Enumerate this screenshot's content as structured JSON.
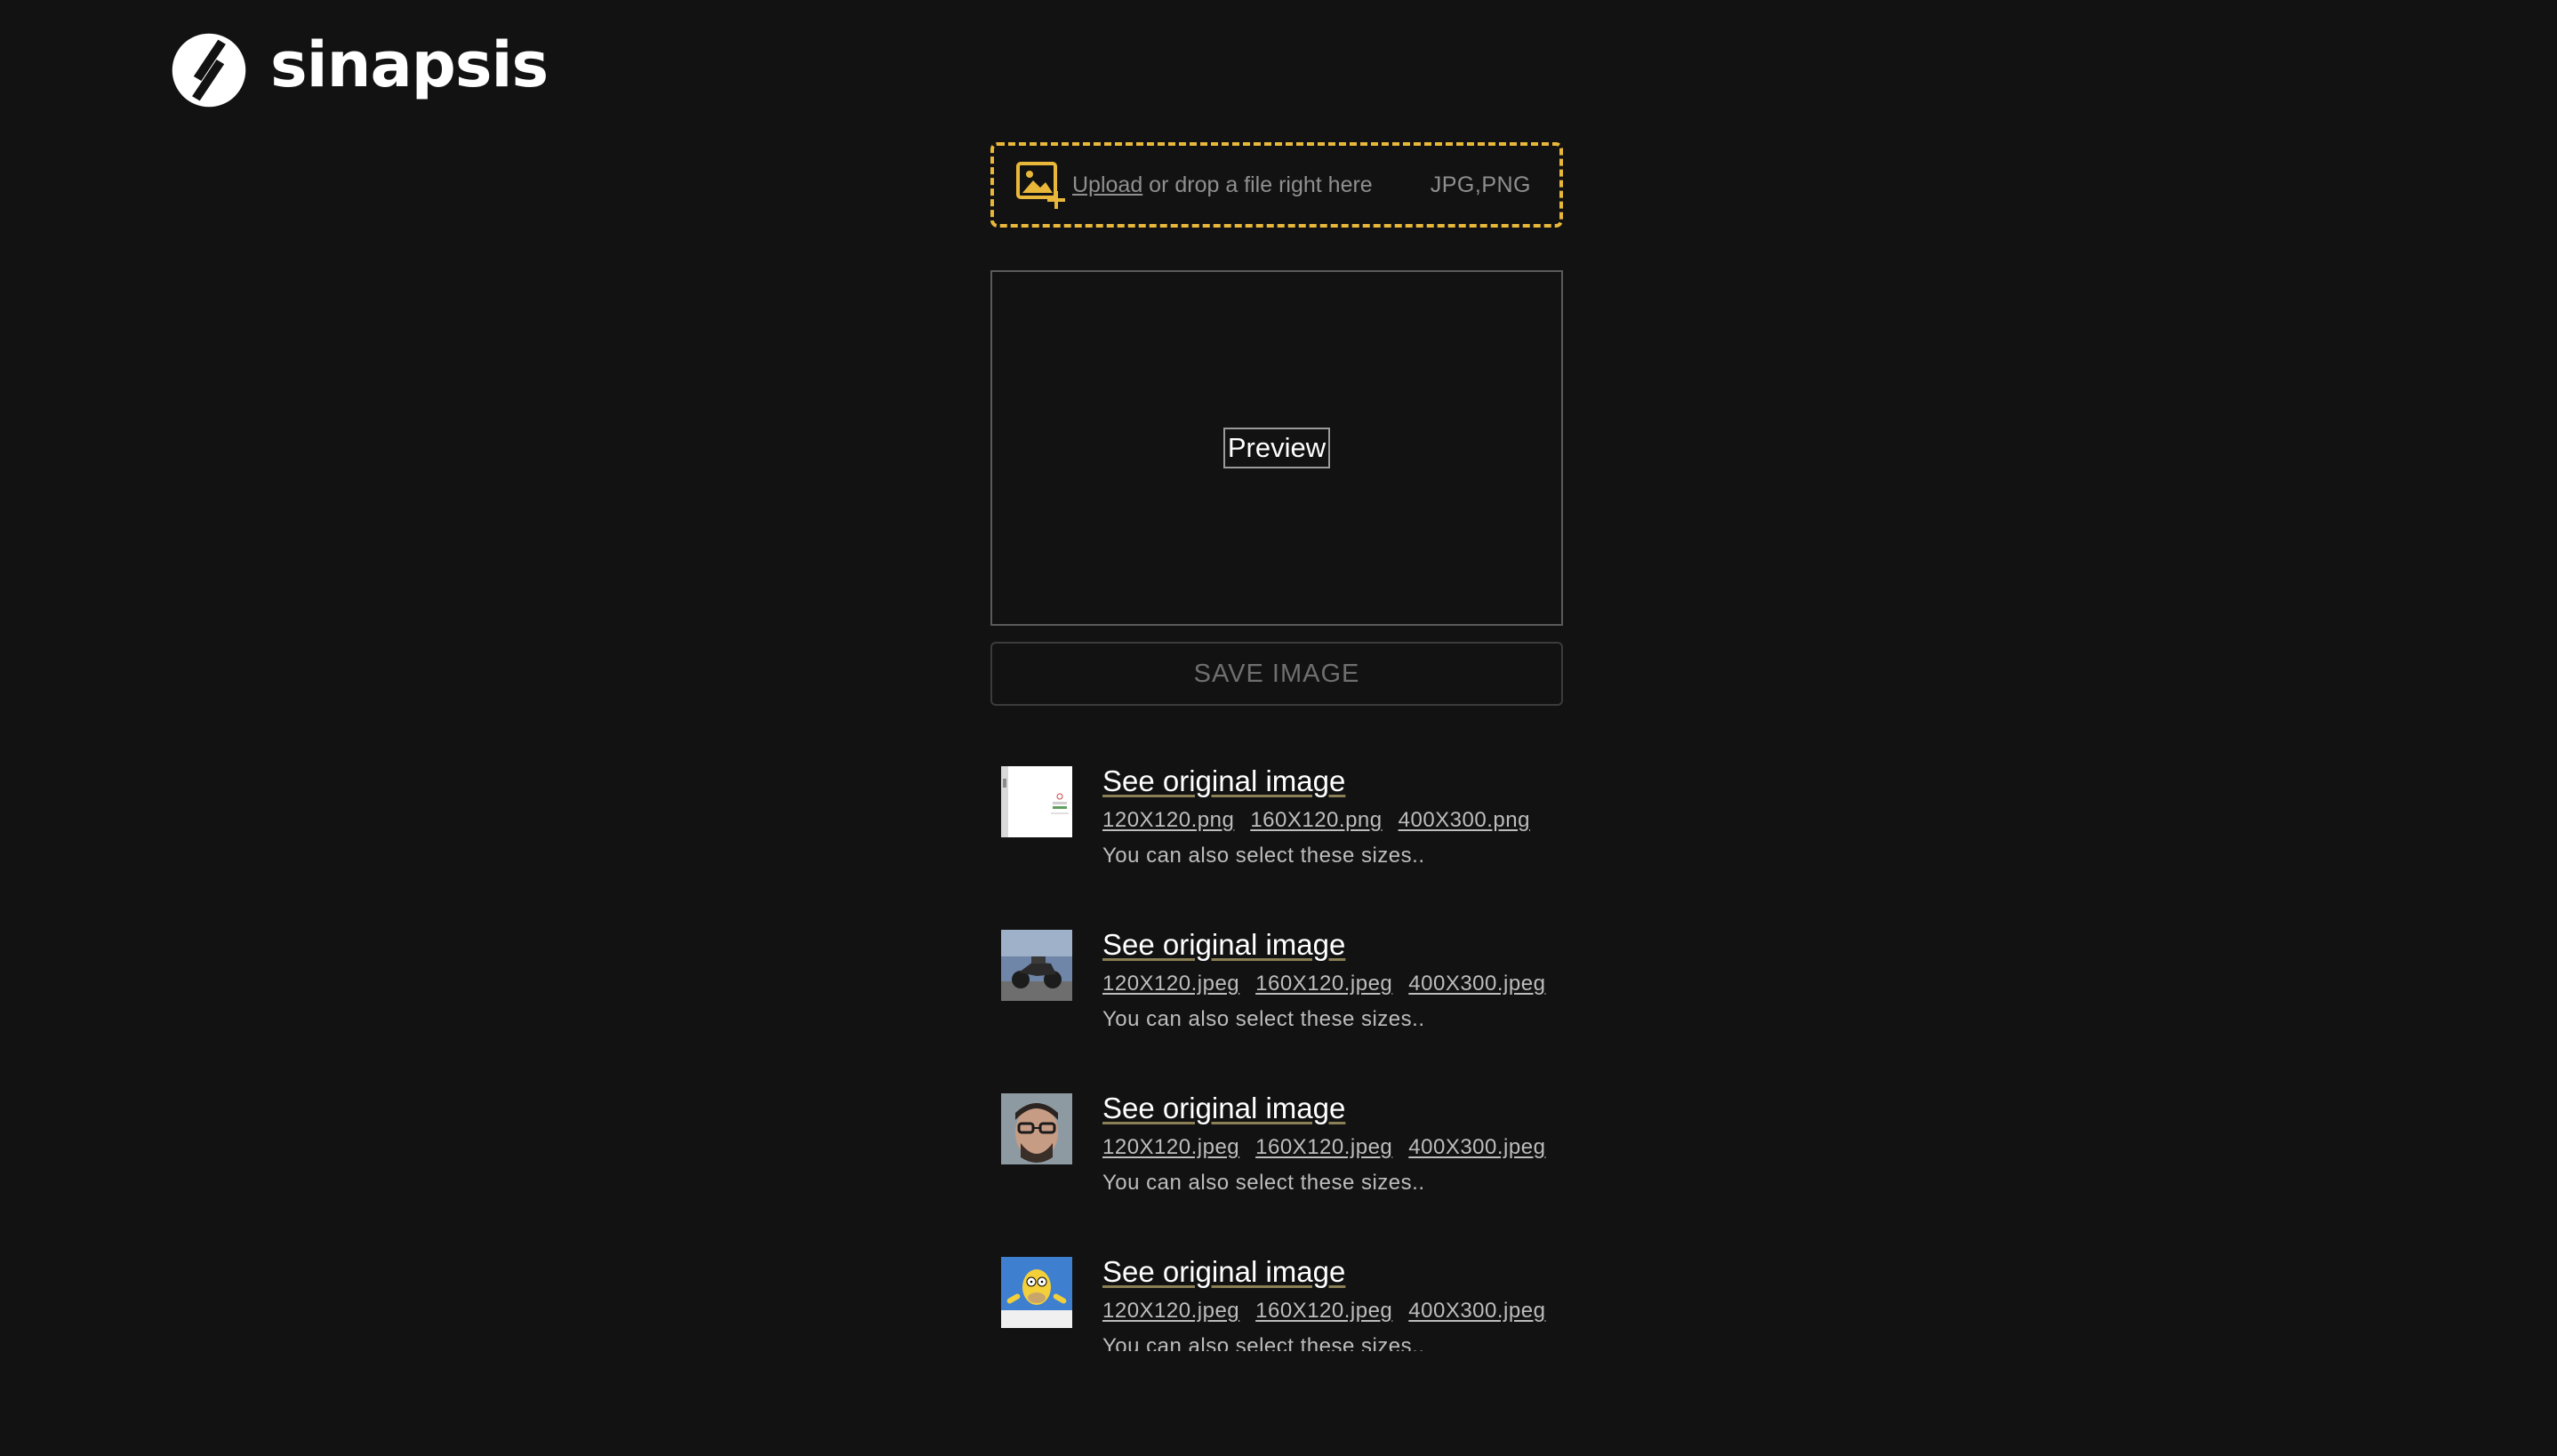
{
  "brand": {
    "name": "sinapsis"
  },
  "upload": {
    "link_label": "Upload",
    "drop_text": " or drop a file right here",
    "formats": "JPG,PNG"
  },
  "preview": {
    "label": "Preview"
  },
  "save_button": {
    "label": "SAVE IMAGE"
  },
  "images": [
    {
      "thumbnail": "document-screenshot-thumbnail",
      "link_label": "See original image",
      "sizes": [
        "120X120.png",
        "160X120.png",
        "400X300.png"
      ],
      "note": "You can also select these sizes.."
    },
    {
      "thumbnail": "motorcycle-thumbnail",
      "link_label": "See original image",
      "sizes": [
        "120X120.jpeg",
        "160X120.jpeg",
        "400X300.jpeg"
      ],
      "note": "You can also select these sizes.."
    },
    {
      "thumbnail": "man-with-glasses-thumbnail",
      "link_label": "See original image",
      "sizes": [
        "120X120.jpeg",
        "160X120.jpeg",
        "400X300.jpeg"
      ],
      "note": "You can also select these sizes.."
    },
    {
      "thumbnail": "cartoon-character-thumbnail",
      "link_label": "See original image",
      "sizes": [
        "120X120.jpeg",
        "160X120.jpeg",
        "400X300.jpeg"
      ],
      "note": "You can also select these sizes.."
    }
  ],
  "colors": {
    "background": "#121212",
    "accent": "#e9b83a",
    "muted_text": "#8f8f8f",
    "link_text": "#bdbdbd"
  }
}
